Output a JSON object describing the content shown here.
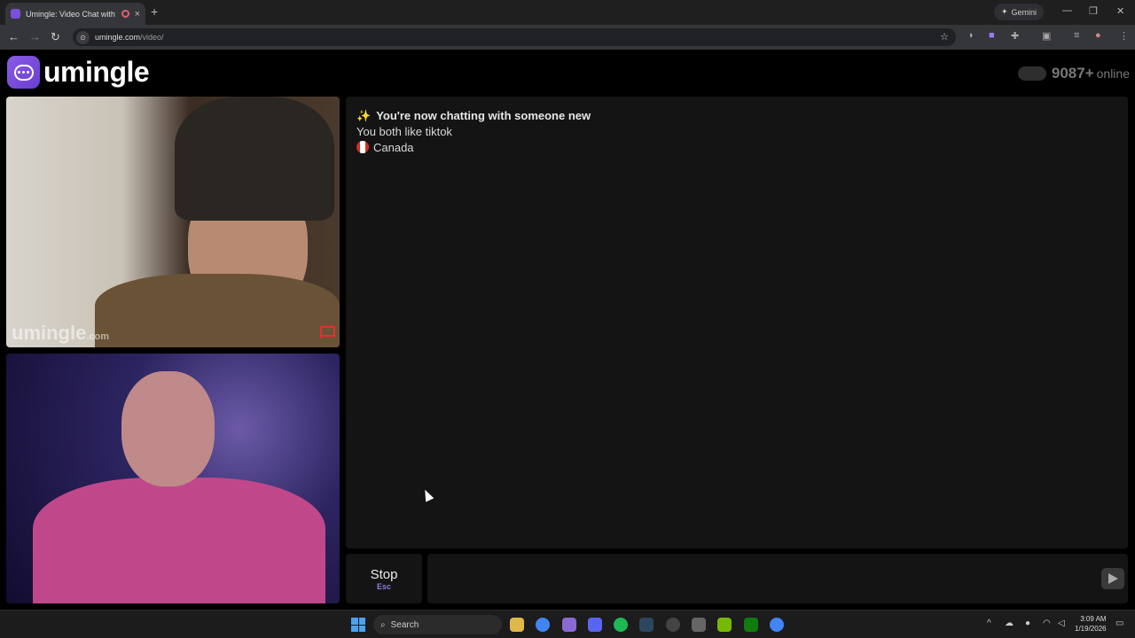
{
  "browser": {
    "tab_title": "Umingle: Video Chat with S",
    "tab_close": "×",
    "new_tab": "+",
    "gemini_label": "Gemini",
    "url_host": "umingle.com",
    "url_path": "/video/",
    "minimize": "—",
    "restore": "❐",
    "close": "✕"
  },
  "header": {
    "logo_text": "umingle",
    "online_count": "9087+",
    "online_label": "online"
  },
  "video": {
    "watermark": "umingle",
    "watermark_suffix": ".com"
  },
  "chat": {
    "headline": "You're now chatting with someone new",
    "interests": "You both like tiktok",
    "country": "Canada"
  },
  "controls": {
    "stop_label": "Stop",
    "stop_key": "Esc",
    "message_placeholder": ""
  },
  "taskbar": {
    "search_label": "Search",
    "time": "3:09 AM",
    "date": "1/19/2026"
  },
  "colors": {
    "brand": "#7b4fd8",
    "report": "#e03030"
  }
}
